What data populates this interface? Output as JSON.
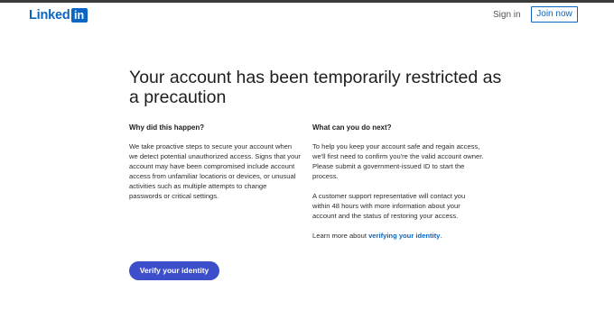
{
  "header": {
    "logo_text": "Linked",
    "logo_box": "in",
    "sign_in": "Sign in",
    "join_now": "Join now"
  },
  "main": {
    "title": "Your account has been temporarily restricted as a precaution",
    "left": {
      "heading": "Why did this happen?",
      "body": "We take proactive steps to secure your account when we detect potential unauthorized access. Signs that your account may have been compromised include account access from unfamiliar locations or devices, or unusual activities such as multiple attempts to change passwords or critical settings."
    },
    "right": {
      "heading": "What can you do next?",
      "para1": "To help you keep your account safe and regain access, we'll first need to confirm you're the valid account owner. Please submit a government-issued ID to start the process.",
      "para2": "A customer support representative will contact you within 48 hours with more information about your account and the status of restoring your access.",
      "learn_prefix": "Learn more about ",
      "learn_link": "verifying your identity",
      "learn_suffix": "."
    },
    "verify_button": "Verify your identity"
  },
  "colors": {
    "brand": "#0a66c2",
    "button": "#3d4ecb"
  }
}
